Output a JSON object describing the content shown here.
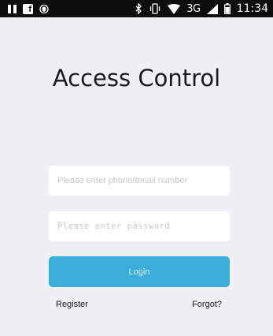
{
  "status_bar": {
    "network": "3G",
    "time": "11:34",
    "icons": [
      "pause-icon",
      "facebook-icon",
      "shield-icon",
      "bluetooth-icon",
      "vibrate-icon",
      "wifi-icon",
      "signal-icon",
      "battery-icon"
    ]
  },
  "app": {
    "title": "Access Control"
  },
  "form": {
    "phone_placeholder": "Please enter phone/email number",
    "password_placeholder": "Please enter password",
    "login_label": "Login"
  },
  "links": {
    "register": "Register",
    "forgot": "Forgot?"
  },
  "colors": {
    "background": "#f0eff4",
    "status_bar": "#0d0d0d",
    "login_button": "#3aaed8",
    "login_text": "#d8f0fa",
    "placeholder": "#c8c8cc"
  }
}
